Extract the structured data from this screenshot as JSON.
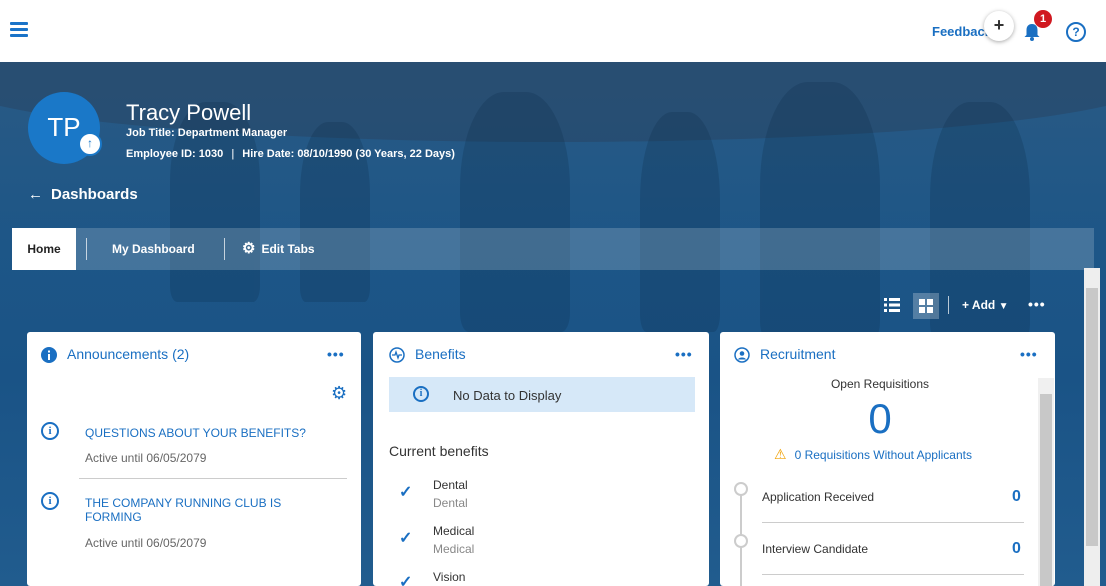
{
  "topbar": {
    "feedback_label": "Feedback",
    "add_label": "+",
    "notification_count": "1",
    "help_label": "?"
  },
  "profile": {
    "initials": "TP",
    "name": "Tracy Powell",
    "job_title": "Job Title: Department Manager",
    "employee_id": "Employee ID: 1030",
    "hire_date": "Hire Date: 08/10/1990 (30 Years, 22 Days)"
  },
  "nav": {
    "back_label": "Dashboards",
    "tabs": [
      {
        "label": "Home",
        "active": true
      },
      {
        "label": "My Dashboard",
        "active": false
      },
      {
        "label": "Edit Tabs",
        "active": false
      }
    ]
  },
  "toolbar": {
    "add_label": "+ Add",
    "more_label": "•••"
  },
  "announcements": {
    "title": "Announcements (2)",
    "more_label": "•••",
    "items": [
      {
        "title": "QUESTIONS ABOUT YOUR BENEFITS?",
        "sub": "Active until 06/05/2079"
      },
      {
        "title": "THE COMPANY RUNNING CLUB IS FORMING",
        "sub": "Active until 06/05/2079"
      }
    ]
  },
  "benefits": {
    "title": "Benefits",
    "more_label": "•••",
    "no_data": "No Data to Display",
    "current_heading": "Current benefits",
    "items": [
      {
        "name": "Dental",
        "sub": "Dental"
      },
      {
        "name": "Medical",
        "sub": "Medical"
      },
      {
        "name": "Vision",
        "sub": ""
      }
    ]
  },
  "recruitment": {
    "title": "Recruitment",
    "more_label": "•••",
    "open_heading": "Open Requisitions",
    "open_count": "0",
    "warning": "0 Requisitions Without Applicants",
    "stages": [
      {
        "label": "Application Received",
        "value": "0"
      },
      {
        "label": "Interview Candidate",
        "value": "0"
      }
    ]
  },
  "colors": {
    "accent": "#1a6fc2",
    "banner": "#1d5687",
    "badge": "#d01820",
    "warning": "#f0a000"
  },
  "icons": [
    "hamburger-icon",
    "bell-icon",
    "help-icon",
    "upload-icon",
    "arrow-left-icon",
    "gear-icon",
    "list-view-icon",
    "grid-view-icon",
    "info-icon",
    "heartbeat-icon",
    "person-search-icon",
    "check-icon",
    "warning-icon"
  ]
}
